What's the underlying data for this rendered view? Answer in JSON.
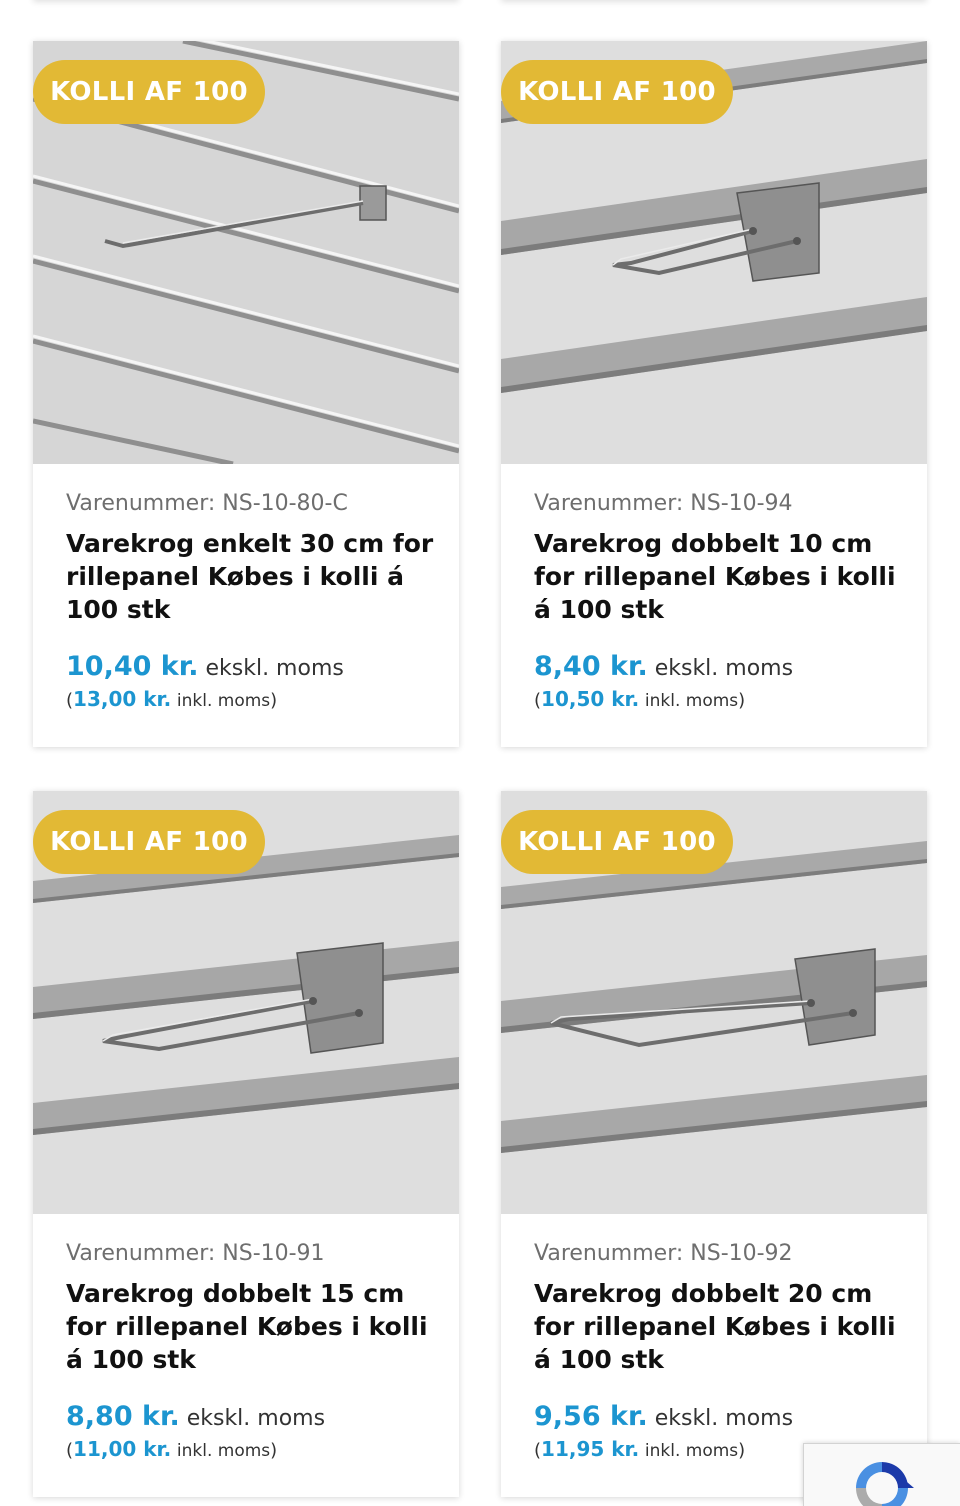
{
  "products": [
    {
      "badge": "KOLLI AF 100",
      "sku": "Varenummer: NS-10-80-C",
      "title": "Varekrog enkelt 30 cm for rillepanel Købes i kolli á 100 stk",
      "price_excl": "10,40 kr.",
      "excl_label": "ekskl. moms",
      "price_incl": "13,00 kr.",
      "incl_label": "inkl. moms"
    },
    {
      "badge": "KOLLI AF 100",
      "sku": "Varenummer: NS-10-94",
      "title": "Varekrog dobbelt 10 cm for rillepanel Købes i kolli á 100 stk",
      "price_excl": "8,40 kr.",
      "excl_label": "ekskl. moms",
      "price_incl": "10,50 kr.",
      "incl_label": "inkl. moms"
    },
    {
      "badge": "KOLLI AF 100",
      "sku": "Varenummer: NS-10-91",
      "title": "Varekrog dobbelt 15 cm for rillepanel Købes i kolli á 100 stk",
      "price_excl": "8,80 kr.",
      "excl_label": "ekskl. moms",
      "price_incl": "11,00 kr.",
      "incl_label": "inkl. moms"
    },
    {
      "badge": "KOLLI AF 100",
      "sku": "Varenummer: NS-10-92",
      "title": "Varekrog dobbelt 20 cm for rillepanel Købes i kolli á 100 stk",
      "price_excl": "9,56 kr.",
      "excl_label": "ekskl. moms",
      "price_incl": "11,95 kr.",
      "incl_label": "inkl. moms"
    }
  ],
  "colors": {
    "badge": "#e2b935",
    "price": "#1c95d0",
    "panel": "#dcdcdc"
  },
  "icons": {
    "recaptcha": "recaptcha-icon"
  }
}
